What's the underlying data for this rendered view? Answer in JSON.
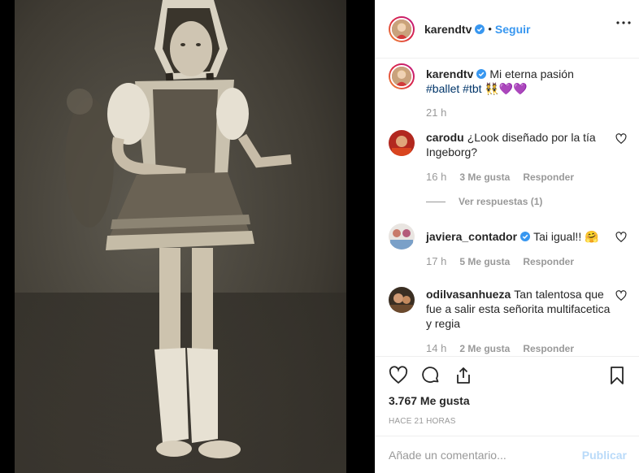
{
  "post": {
    "author": "karendtv",
    "follow_label": "Seguir",
    "separator": "•",
    "caption_prefix": "Mi eterna pasión",
    "hashtags": [
      "#ballet",
      "#tbt"
    ],
    "emoji": "👯💜💜",
    "caption_time": "21 h",
    "likes": "3.767 Me gusta",
    "posted_ago": "HACE 21 HORAS"
  },
  "comments": [
    {
      "username": "carodu",
      "text": "¿Look diseñado por la tía Ingeborg?",
      "time": "16 h",
      "likes": "3 Me gusta",
      "reply_label": "Responder",
      "replies_label": "Ver respuestas (1)"
    },
    {
      "username": "javiera_contador",
      "text": "Tai igual!! 🤗",
      "time": "17 h",
      "likes": "5 Me gusta",
      "reply_label": "Responder"
    },
    {
      "username": "odilvasanhueza",
      "text": "Tan talentosa que fue a salir esta señorita multifacetica y regia",
      "time": "14 h",
      "likes": "2 Me gusta",
      "reply_label": "Responder"
    }
  ],
  "comment_box": {
    "placeholder": "Añade un comentario...",
    "publish_label": "Publicar"
  },
  "colors": {
    "link_blue": "#3897f0",
    "hashtag": "#003569",
    "muted": "#999999",
    "verified": "#3897f0"
  },
  "icons": [
    "more-icon",
    "verified-icon",
    "heart-icon",
    "comment-icon",
    "share-icon",
    "bookmark-icon"
  ]
}
